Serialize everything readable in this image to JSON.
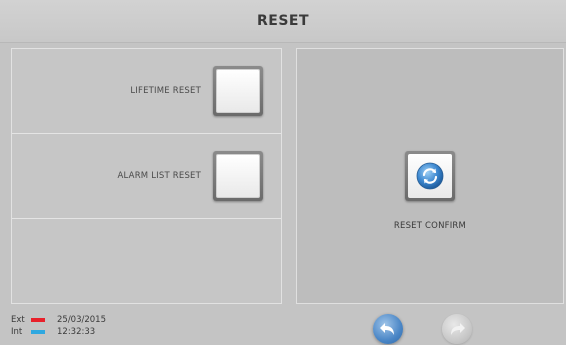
{
  "header": {
    "title": "RESET"
  },
  "options": [
    {
      "label": "LIFETIME RESET",
      "checked": false
    },
    {
      "label": "ALARM LIST RESET",
      "checked": false
    }
  ],
  "confirm": {
    "label": "RESET CONFIRM",
    "icon": "refresh-icon"
  },
  "footer": {
    "legend": [
      {
        "key": "Ext",
        "color": "#e8202a",
        "value": "25/03/2015"
      },
      {
        "key": "Int",
        "color": "#2fa8e0",
        "value": "12:32:33"
      }
    ],
    "nav": {
      "back_icon": "back-arrow-icon",
      "forward_icon": "forward-arrow-icon",
      "forward_enabled": false
    }
  }
}
